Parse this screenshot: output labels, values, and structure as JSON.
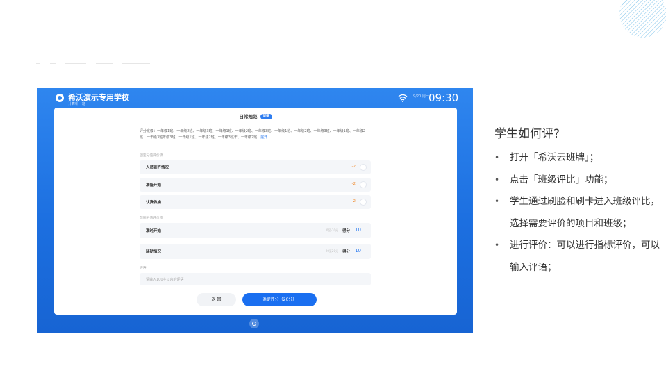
{
  "device": {
    "school_name": "希沃演示专用学校",
    "class_name": "计算机一班",
    "date": "9/20 周一",
    "time": "09:30"
  },
  "form": {
    "title": "日常规范",
    "title_badge": "记录",
    "scope_label": "评分班级：",
    "scope_classes": "一年级1班、一年级2班、一年级3班、一年级1班、一年级2班、一年级3班、一年级1班、一年级2班、一年级3班、一年级1班、一年级2班、一年级3班年级3班、一年级1班、一年级2班、一年级3班年、一年级2班、",
    "scope_more": "展开",
    "fixed_section_label": "固定分值评价项",
    "fixed_items": [
      {
        "label": "人员到齐情况",
        "score": "-2"
      },
      {
        "label": "准备开始",
        "score": "-2"
      },
      {
        "label": "认真做操",
        "score": "-2"
      }
    ],
    "range_section_label": "范围分值评价项",
    "range_items": [
      {
        "label": "准时开始",
        "range": "0至-10分",
        "score_label": "得分",
        "score": "10"
      },
      {
        "label": "缺勤情况",
        "range": "-20至20分",
        "score_label": "得分",
        "score": "10"
      }
    ],
    "comment_label": "评语",
    "comment_placeholder": "请输入100字以内的评语",
    "back_button": "返 回",
    "confirm_button": "确定评分（20分）"
  },
  "guide": {
    "heading": "学生如何评?",
    "bullets": [
      "打开「希沃云班牌」；",
      "点击「班级评比」功能；",
      "学生通过刷脸和刷卡进入班级评比，选择需要评价的项目和班级；",
      "进行评价：可以进行指标评价，可以输入评语；"
    ]
  }
}
